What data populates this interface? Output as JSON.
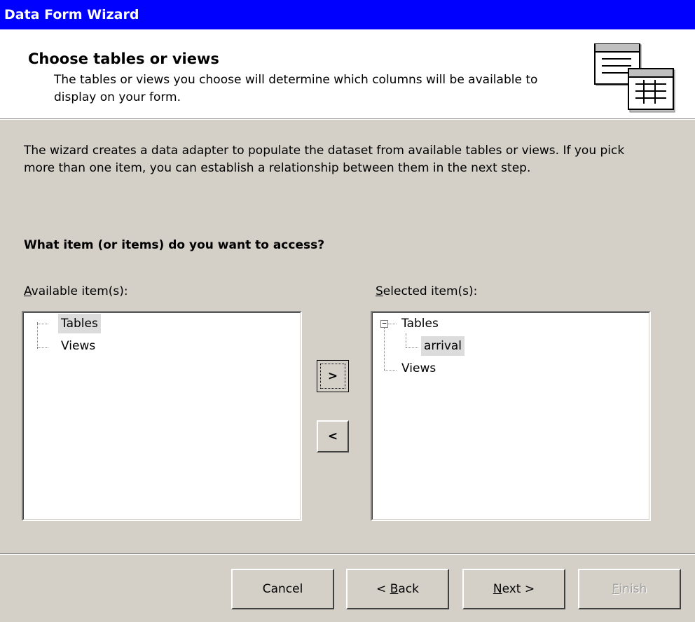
{
  "window": {
    "title": "Data Form Wizard"
  },
  "header": {
    "title": "Choose tables or views",
    "description": "The tables or views you choose will determine which columns will be available to display on your form.",
    "icon": "table-grid-icon"
  },
  "body": {
    "intro": "The wizard creates a data adapter to populate the dataset from available tables or views. If you pick more than one item, you can establish a relationship between them in the next step.",
    "question": "What item (or items) do you want to access?"
  },
  "available": {
    "label_accel": "A",
    "label_rest": "vailable item(s):",
    "items": [
      "Tables",
      "Views"
    ]
  },
  "selected": {
    "label_accel": "S",
    "label_rest": "elected item(s):",
    "root": "Tables",
    "child": "arrival",
    "second": "Views",
    "expander": "−"
  },
  "move": {
    "add_label": ">",
    "remove_label": "<"
  },
  "footer": {
    "cancel_label": "Cancel",
    "back_prefix": "< ",
    "back_accel": "B",
    "back_rest": "ack",
    "next_accel": "N",
    "next_rest": "ext >",
    "finish_accel": "F",
    "finish_rest": "inish"
  }
}
